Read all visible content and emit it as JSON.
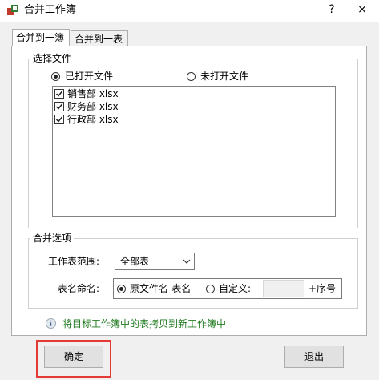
{
  "window": {
    "title": "合并工作簿",
    "help_label": "?",
    "close_label": "×"
  },
  "tabs": [
    {
      "label": "合并到一簿",
      "active": true
    },
    {
      "label": "合并到一表",
      "active": false
    }
  ],
  "select_files": {
    "title": "选择文件",
    "radio_opened": {
      "label": "已打开文件",
      "checked": true
    },
    "radio_unopened": {
      "label": "未打开文件",
      "checked": false
    },
    "files": [
      {
        "label": "销售部 xlsx",
        "checked": true
      },
      {
        "label": "财务部 xlsx",
        "checked": true
      },
      {
        "label": "行政部 xlsx",
        "checked": true
      }
    ]
  },
  "merge_options": {
    "title": "合并选项",
    "range_label": "工作表范围:",
    "range_value": "全部表",
    "naming_label": "表名命名:",
    "naming_original": {
      "label": "原文件名-表名",
      "checked": true
    },
    "naming_custom": {
      "label": "自定义:",
      "checked": false
    },
    "custom_value": "",
    "suffix_label": "+序号"
  },
  "info": {
    "text": "将目标工作簿中的表拷贝到新工作簿中",
    "color": "#1f7a1f"
  },
  "buttons": {
    "ok": "确定",
    "exit": "退出"
  },
  "colors": {
    "highlight": "#e53935"
  }
}
